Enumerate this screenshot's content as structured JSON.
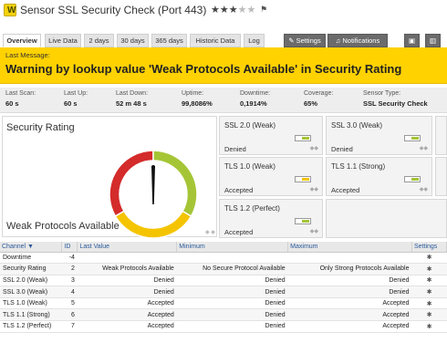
{
  "header": {
    "title": "Sensor SSL Security Check (Port 443)",
    "stars_filled": 3,
    "stars_total": 5
  },
  "tabs": [
    {
      "label": "Overview",
      "active": true
    },
    {
      "label": "Live Data"
    },
    {
      "label": "2 days"
    },
    {
      "label": "30 days"
    },
    {
      "label": "365 days"
    },
    {
      "label": "Historic Data"
    },
    {
      "label": "Log"
    },
    {
      "label": "Settings",
      "icon": "wrench-icon"
    },
    {
      "label": "Notifications",
      "icon": "bell-icon"
    }
  ],
  "banner": {
    "label": "Last Message:",
    "message": "Warning by lookup value 'Weak Protocols Available' in Security Rating"
  },
  "stats": [
    {
      "label": "Last Scan:",
      "value": "60 s"
    },
    {
      "label": "Last Up:",
      "value": "60 s"
    },
    {
      "label": "Last Down:",
      "value": "52 m 48 s"
    },
    {
      "label": "Uptime:",
      "value": "99,8086%"
    },
    {
      "label": "Downtime:",
      "value": "0,1914%"
    },
    {
      "label": "Coverage:",
      "value": "65%"
    },
    {
      "label": "Sensor Type:",
      "value": "SSL Security Check"
    }
  ],
  "gauge": {
    "title": "Security Rating",
    "value_label": "Weak Protocols Available",
    "colors": {
      "red": "#d42b2b",
      "yellow": "#f5c400",
      "green": "#a5c536"
    }
  },
  "tiles": [
    {
      "name": "SSL 2.0 (Weak)",
      "value": "Denied",
      "color": "#a5c536"
    },
    {
      "name": "SSL 3.0 (Weak)",
      "value": "Denied",
      "color": "#a5c536"
    },
    {
      "name": "TLS 1.0 (Weak)",
      "value": "Accepted",
      "color": "#f5c400"
    },
    {
      "name": "TLS 1.1 (Strong)",
      "value": "Accepted",
      "color": "#a5c536"
    },
    {
      "name": "TLS 1.2 (Perfect)",
      "value": "Accepted",
      "color": "#a5c536"
    }
  ],
  "table": {
    "headers": [
      "Channel",
      "ID",
      "Last Value",
      "Minimum",
      "Maximum",
      "Settings"
    ],
    "rows": [
      {
        "channel": "Downtime",
        "id": "-4",
        "last": "",
        "min": "",
        "max": ""
      },
      {
        "channel": "Security Rating",
        "id": "2",
        "last": "Weak Protocols Available",
        "min": "No Secure Protocol Available",
        "max": "Only Strong Protocols Available"
      },
      {
        "channel": "SSL 2.0 (Weak)",
        "id": "3",
        "last": "Denied",
        "min": "Denied",
        "max": "Denied"
      },
      {
        "channel": "SSL 3.0 (Weak)",
        "id": "4",
        "last": "Denied",
        "min": "Denied",
        "max": "Denied"
      },
      {
        "channel": "TLS 1.0 (Weak)",
        "id": "5",
        "last": "Accepted",
        "min": "Denied",
        "max": "Accepted"
      },
      {
        "channel": "TLS 1.1 (Strong)",
        "id": "6",
        "last": "Accepted",
        "min": "Denied",
        "max": "Accepted"
      },
      {
        "channel": "TLS 1.2 (Perfect)",
        "id": "7",
        "last": "Accepted",
        "min": "Denied",
        "max": "Accepted"
      }
    ]
  }
}
